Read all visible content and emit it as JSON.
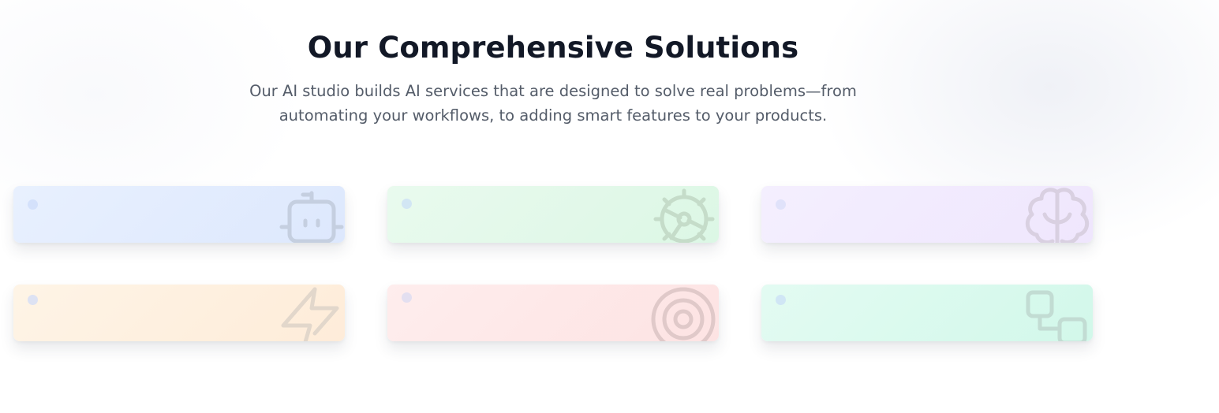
{
  "section": {
    "title": "Our Comprehensive Solutions",
    "subtitle_line1": "Our AI studio builds AI services that are designed to solve real problems—from",
    "subtitle_line2": "automating your workflows, to adding smart features to your products."
  },
  "cards": [
    {
      "icon": "robot-icon",
      "bg": "#e3ecfd",
      "icon_color": "#c5cfe0"
    },
    {
      "icon": "gear-icon",
      "bg": "#e1f8e8",
      "icon_color": "#c5dcc9"
    },
    {
      "icon": "brain-icon",
      "bg": "#f1eafd",
      "icon_color": "#d9d0e1"
    },
    {
      "icon": "lightning-icon",
      "bg": "#fef0df",
      "icon_color": "#e2d7cb"
    },
    {
      "icon": "target-icon",
      "bg": "#fde8e8",
      "icon_color": "#e0c9c9"
    },
    {
      "icon": "workflow-icon",
      "bg": "#d9f9ee",
      "icon_color": "#c2dcd3"
    }
  ]
}
